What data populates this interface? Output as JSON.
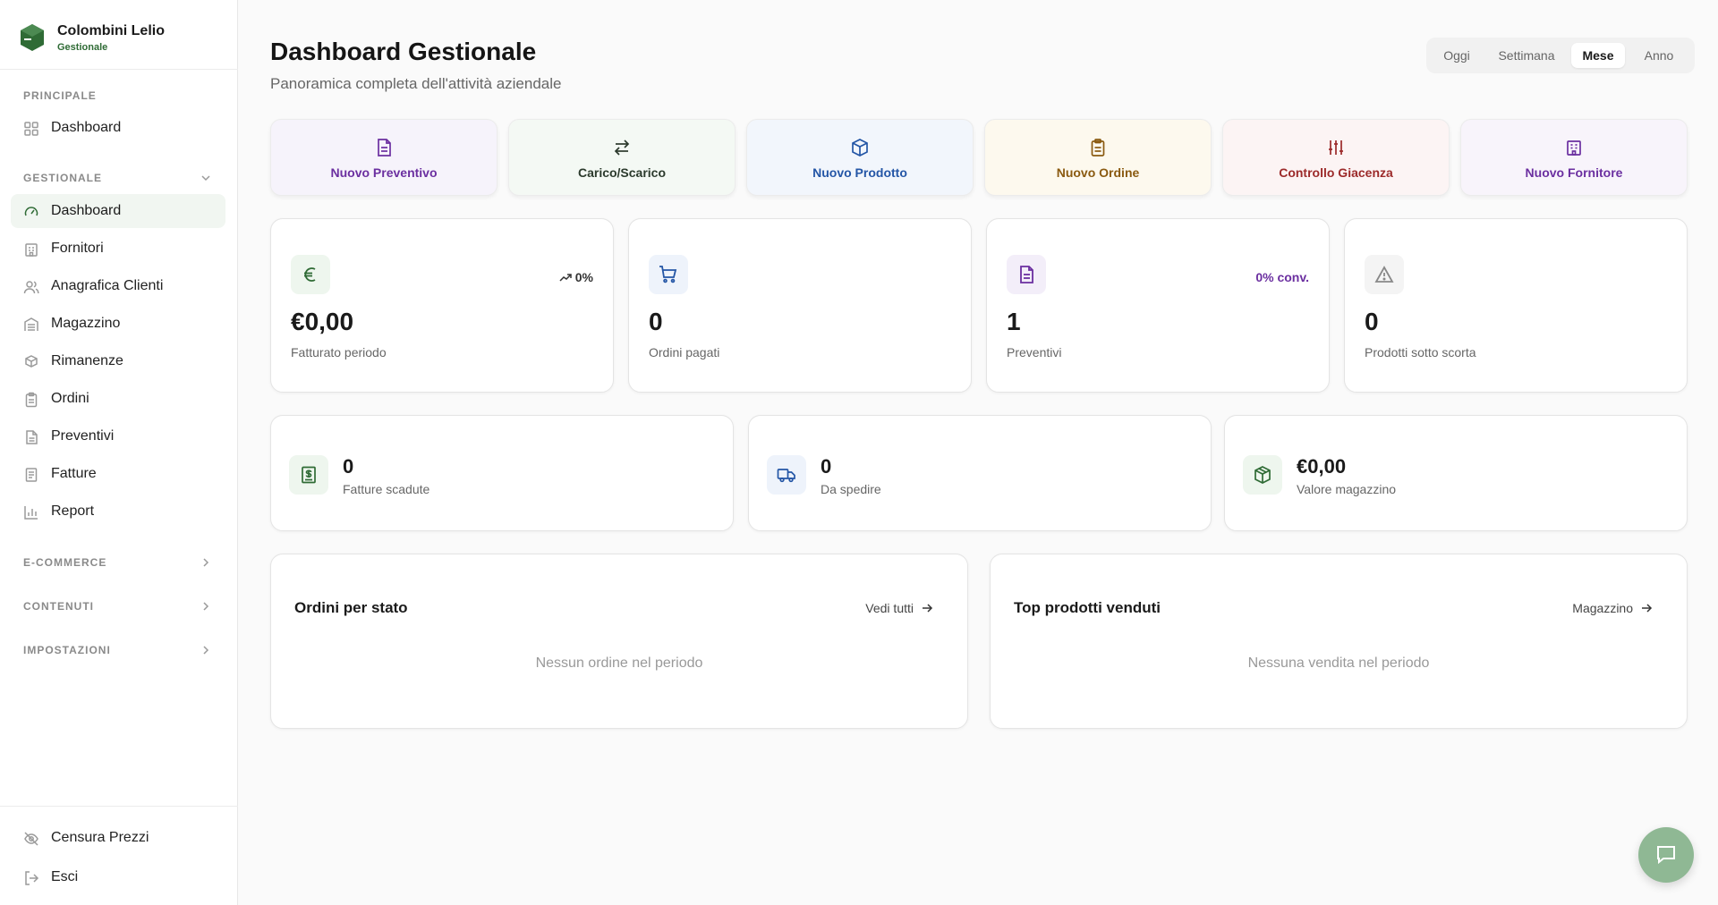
{
  "brand": {
    "name": "Colombini Lelio",
    "subtitle": "Gestionale"
  },
  "sidebar": {
    "principale": {
      "title": "PRINCIPALE",
      "items": [
        {
          "label": "Dashboard",
          "icon": "grid-icon"
        }
      ]
    },
    "gestionale": {
      "title": "GESTIONALE",
      "items": [
        {
          "label": "Dashboard",
          "icon": "gauge-icon",
          "active": true
        },
        {
          "label": "Fornitori",
          "icon": "building-icon"
        },
        {
          "label": "Anagrafica Clienti",
          "icon": "users-icon"
        },
        {
          "label": "Magazzino",
          "icon": "warehouse-icon"
        },
        {
          "label": "Rimanenze",
          "icon": "boxes-icon"
        },
        {
          "label": "Ordini",
          "icon": "clipboard-icon"
        },
        {
          "label": "Preventivi",
          "icon": "file-icon"
        },
        {
          "label": "Fatture",
          "icon": "receipt-icon"
        },
        {
          "label": "Report",
          "icon": "bar-chart-icon"
        }
      ]
    },
    "collapsed_sections": [
      "E-COMMERCE",
      "CONTENUTI",
      "IMPOSTAZIONI"
    ],
    "bottom": [
      {
        "label": "Censura Prezzi",
        "icon": "eye-off-icon"
      },
      {
        "label": "Esci",
        "icon": "logout-icon"
      }
    ]
  },
  "header": {
    "title": "Dashboard Gestionale",
    "subtitle": "Panoramica completa dell'attività aziendale",
    "periods": [
      "Oggi",
      "Settimana",
      "Mese",
      "Anno"
    ],
    "active_period": "Mese"
  },
  "quick_actions": [
    {
      "label": "Nuovo Preventivo",
      "icon": "file-icon",
      "color": "#6b2fa0",
      "bg": "#f6f3fb"
    },
    {
      "label": "Carico/Scarico",
      "icon": "arrows-swap-icon",
      "color": "#2b3a2c",
      "bg": "#f4f9f4"
    },
    {
      "label": "Nuovo Prodotto",
      "icon": "package-icon",
      "color": "#2456a6",
      "bg": "#f2f6fc"
    },
    {
      "label": "Nuovo Ordine",
      "icon": "clipboard-icon",
      "color": "#8a5a10",
      "bg": "#fdf9ee"
    },
    {
      "label": "Controllo Giacenza",
      "icon": "sliders-icon",
      "color": "#9c2a2a",
      "bg": "#fcf4f4"
    },
    {
      "label": "Nuovo Fornitore",
      "icon": "building-icon",
      "color": "#6b2fa0",
      "bg": "#f8f4fb"
    }
  ],
  "stats": [
    {
      "value": "€0,00",
      "label": "Fatturato periodo",
      "trend": "0%",
      "icon": "euro-icon",
      "color": "#2f6b35",
      "bg": "#eef6ee",
      "trend_color": "#333333"
    },
    {
      "value": "0",
      "label": "Ordini pagati",
      "trend": "",
      "icon": "cart-icon",
      "color": "#2456a6",
      "bg": "#eef3fb"
    },
    {
      "value": "1",
      "label": "Preventivi",
      "trend": "0% conv.",
      "icon": "file-icon",
      "color": "#6b2fa0",
      "bg": "#f3eef9",
      "trend_color": "#6b2fa0"
    },
    {
      "value": "0",
      "label": "Prodotti sotto scorta",
      "trend": "",
      "icon": "warning-icon",
      "color": "#888888",
      "bg": "#f4f4f4"
    }
  ],
  "mini_stats": [
    {
      "value": "0",
      "label": "Fatture scadute",
      "icon": "receipt-dollar-icon",
      "color": "#2f6b35",
      "bg": "#eef6ee"
    },
    {
      "value": "0",
      "label": "Da spedire",
      "icon": "truck-icon",
      "color": "#2456a6",
      "bg": "#eef3fb"
    },
    {
      "value": "€0,00",
      "label": "Valore magazzino",
      "icon": "package-icon",
      "color": "#2f6b35",
      "bg": "#eef6ee"
    }
  ],
  "panels": [
    {
      "title": "Ordini per stato",
      "link": "Vedi tutti",
      "empty": "Nessun ordine nel periodo"
    },
    {
      "title": "Top prodotti venduti",
      "link": "Magazzino",
      "empty": "Nessuna vendita nel periodo"
    }
  ],
  "colors": {
    "brand_green": "#2f6b35",
    "fab": "#8fb894"
  }
}
